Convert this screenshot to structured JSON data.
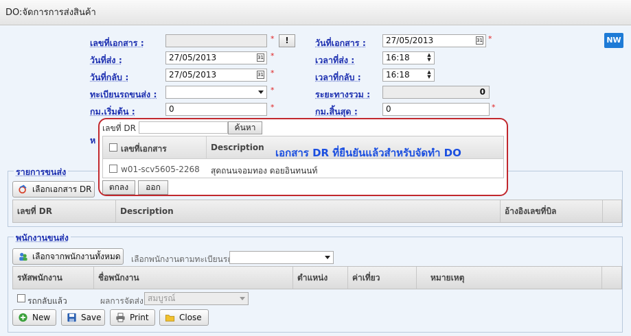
{
  "window": {
    "title": "DO:จัดการการส่งสินค้า"
  },
  "badge": "NW",
  "form": {
    "doc_no": {
      "label": "เลขที่เอกสาร :",
      "value": ""
    },
    "doc_btn": "!",
    "doc_date": {
      "label": "วันที่เอกสาร :",
      "value": "27/05/2013"
    },
    "ship_date": {
      "label": "วันที่ส่ง :",
      "value": "27/05/2013"
    },
    "ship_time": {
      "label": "เวลาที่ส่ง :",
      "value": "16:18"
    },
    "return_date": {
      "label": "วันที่กลับ :",
      "value": "27/05/2013"
    },
    "return_time": {
      "label": "เวลาที่กลับ :",
      "value": "16:18"
    },
    "truck_reg": {
      "label": "ทะเบียนรถขนส่ง :",
      "value": ""
    },
    "total_distance": {
      "label": "ระยะทางรวม :",
      "value": "0"
    },
    "km_start": {
      "label": "กม.เริ่มต้น :",
      "value": "0"
    },
    "km_end": {
      "label": "กม.สิ้นสุด :",
      "value": "0"
    },
    "hidden_label_fragment": "ห"
  },
  "shipping": {
    "legend": "รายการขนส่ง",
    "select_dr_button": "เลือกเอกสาร DR",
    "columns": [
      "เลขที่ DR",
      "Description",
      "อ้างอิงเลขที่บิล"
    ]
  },
  "staff": {
    "legend": "พนักงานขนส่ง",
    "select_all_button": "เลือกจากพนักงานทั้งหมด",
    "select_by_truck_label": "เลือกพนักงานตามทะเบียนรถ :",
    "select_by_truck_value": "",
    "columns": [
      "รหัสพนักงาน",
      "ชื่อพนักงาน",
      "ตำแหน่ง",
      "ค่าเที่ยว",
      "หมายเหตุ"
    ]
  },
  "footer": {
    "truck_returned_label": "รถกลับแล้ว",
    "delivery_result_label": "ผลการจัดส่ง",
    "delivery_result_value": "สมบูรณ์",
    "buttons": {
      "new": "New",
      "save": "Save",
      "print": "Print",
      "close": "Close"
    }
  },
  "popup": {
    "search_label": "เลขที่ DR",
    "search_value": "",
    "search_button": "ค้นหา",
    "columns": [
      "เลขที่เอกสาร",
      "Description"
    ],
    "rows": [
      {
        "doc_no": "w01-scv5605-2268",
        "description": "สุดถนนจอมทอง ดอยอินทนนท์"
      }
    ],
    "note": "เอกสาร DR ที่ยืนยันแล้วสำหรับจัดทำ DO",
    "ok_button": "ตกลง",
    "exit_button": "ออก"
  },
  "colors": {
    "label_blue": "#1c2fb0",
    "required_red": "#e02020",
    "popup_border": "#c1272d",
    "note_blue": "#1b4fe0",
    "badge_blue": "#1e7bd6"
  }
}
